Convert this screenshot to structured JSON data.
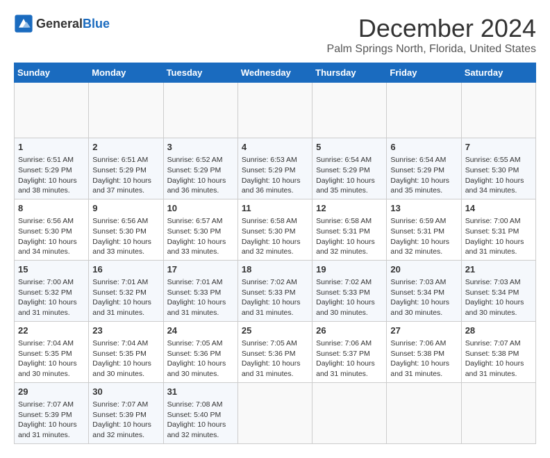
{
  "header": {
    "logo_general": "General",
    "logo_blue": "Blue",
    "month_title": "December 2024",
    "location": "Palm Springs North, Florida, United States"
  },
  "calendar": {
    "days_of_week": [
      "Sunday",
      "Monday",
      "Tuesday",
      "Wednesday",
      "Thursday",
      "Friday",
      "Saturday"
    ],
    "weeks": [
      [
        {
          "day": "",
          "empty": true
        },
        {
          "day": "",
          "empty": true
        },
        {
          "day": "",
          "empty": true
        },
        {
          "day": "",
          "empty": true
        },
        {
          "day": "",
          "empty": true
        },
        {
          "day": "",
          "empty": true
        },
        {
          "day": "",
          "empty": true
        }
      ],
      [
        {
          "day": "1",
          "sunrise": "6:51 AM",
          "sunset": "5:29 PM",
          "daylight": "10 hours and 38 minutes."
        },
        {
          "day": "2",
          "sunrise": "6:51 AM",
          "sunset": "5:29 PM",
          "daylight": "10 hours and 37 minutes."
        },
        {
          "day": "3",
          "sunrise": "6:52 AM",
          "sunset": "5:29 PM",
          "daylight": "10 hours and 36 minutes."
        },
        {
          "day": "4",
          "sunrise": "6:53 AM",
          "sunset": "5:29 PM",
          "daylight": "10 hours and 36 minutes."
        },
        {
          "day": "5",
          "sunrise": "6:54 AM",
          "sunset": "5:29 PM",
          "daylight": "10 hours and 35 minutes."
        },
        {
          "day": "6",
          "sunrise": "6:54 AM",
          "sunset": "5:29 PM",
          "daylight": "10 hours and 35 minutes."
        },
        {
          "day": "7",
          "sunrise": "6:55 AM",
          "sunset": "5:30 PM",
          "daylight": "10 hours and 34 minutes."
        }
      ],
      [
        {
          "day": "8",
          "sunrise": "6:56 AM",
          "sunset": "5:30 PM",
          "daylight": "10 hours and 34 minutes."
        },
        {
          "day": "9",
          "sunrise": "6:56 AM",
          "sunset": "5:30 PM",
          "daylight": "10 hours and 33 minutes."
        },
        {
          "day": "10",
          "sunrise": "6:57 AM",
          "sunset": "5:30 PM",
          "daylight": "10 hours and 33 minutes."
        },
        {
          "day": "11",
          "sunrise": "6:58 AM",
          "sunset": "5:30 PM",
          "daylight": "10 hours and 32 minutes."
        },
        {
          "day": "12",
          "sunrise": "6:58 AM",
          "sunset": "5:31 PM",
          "daylight": "10 hours and 32 minutes."
        },
        {
          "day": "13",
          "sunrise": "6:59 AM",
          "sunset": "5:31 PM",
          "daylight": "10 hours and 32 minutes."
        },
        {
          "day": "14",
          "sunrise": "7:00 AM",
          "sunset": "5:31 PM",
          "daylight": "10 hours and 31 minutes."
        }
      ],
      [
        {
          "day": "15",
          "sunrise": "7:00 AM",
          "sunset": "5:32 PM",
          "daylight": "10 hours and 31 minutes."
        },
        {
          "day": "16",
          "sunrise": "7:01 AM",
          "sunset": "5:32 PM",
          "daylight": "10 hours and 31 minutes."
        },
        {
          "day": "17",
          "sunrise": "7:01 AM",
          "sunset": "5:33 PM",
          "daylight": "10 hours and 31 minutes."
        },
        {
          "day": "18",
          "sunrise": "7:02 AM",
          "sunset": "5:33 PM",
          "daylight": "10 hours and 31 minutes."
        },
        {
          "day": "19",
          "sunrise": "7:02 AM",
          "sunset": "5:33 PM",
          "daylight": "10 hours and 30 minutes."
        },
        {
          "day": "20",
          "sunrise": "7:03 AM",
          "sunset": "5:34 PM",
          "daylight": "10 hours and 30 minutes."
        },
        {
          "day": "21",
          "sunrise": "7:03 AM",
          "sunset": "5:34 PM",
          "daylight": "10 hours and 30 minutes."
        }
      ],
      [
        {
          "day": "22",
          "sunrise": "7:04 AM",
          "sunset": "5:35 PM",
          "daylight": "10 hours and 30 minutes."
        },
        {
          "day": "23",
          "sunrise": "7:04 AM",
          "sunset": "5:35 PM",
          "daylight": "10 hours and 30 minutes."
        },
        {
          "day": "24",
          "sunrise": "7:05 AM",
          "sunset": "5:36 PM",
          "daylight": "10 hours and 30 minutes."
        },
        {
          "day": "25",
          "sunrise": "7:05 AM",
          "sunset": "5:36 PM",
          "daylight": "10 hours and 31 minutes."
        },
        {
          "day": "26",
          "sunrise": "7:06 AM",
          "sunset": "5:37 PM",
          "daylight": "10 hours and 31 minutes."
        },
        {
          "day": "27",
          "sunrise": "7:06 AM",
          "sunset": "5:38 PM",
          "daylight": "10 hours and 31 minutes."
        },
        {
          "day": "28",
          "sunrise": "7:07 AM",
          "sunset": "5:38 PM",
          "daylight": "10 hours and 31 minutes."
        }
      ],
      [
        {
          "day": "29",
          "sunrise": "7:07 AM",
          "sunset": "5:39 PM",
          "daylight": "10 hours and 31 minutes."
        },
        {
          "day": "30",
          "sunrise": "7:07 AM",
          "sunset": "5:39 PM",
          "daylight": "10 hours and 32 minutes."
        },
        {
          "day": "31",
          "sunrise": "7:08 AM",
          "sunset": "5:40 PM",
          "daylight": "10 hours and 32 minutes."
        },
        {
          "day": "",
          "empty": true
        },
        {
          "day": "",
          "empty": true
        },
        {
          "day": "",
          "empty": true
        },
        {
          "day": "",
          "empty": true
        }
      ]
    ]
  }
}
